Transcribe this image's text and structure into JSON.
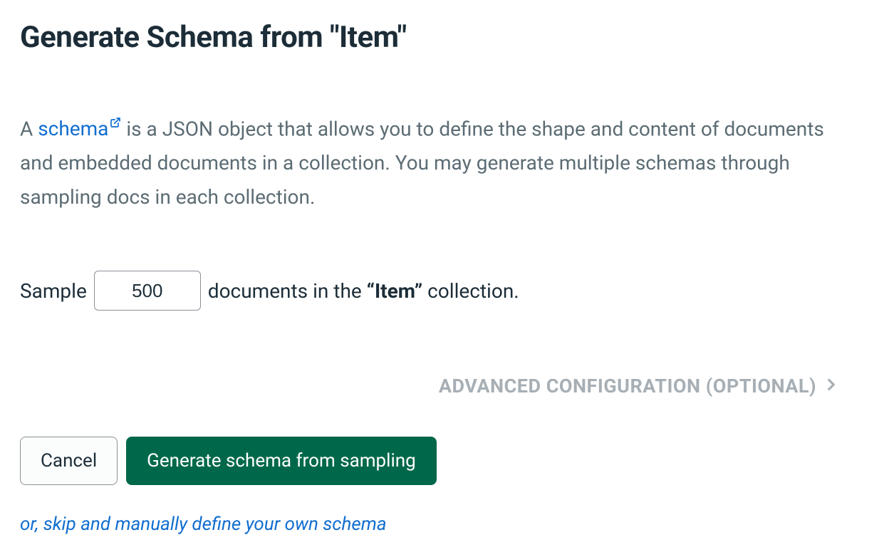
{
  "heading": "Generate Schema from \"Item\"",
  "description": {
    "prefix": "A ",
    "link_text": "schema",
    "suffix": " is a JSON object that allows you to define the shape and content of documents and embedded documents in a collection. You may generate multiple schemas through sampling docs in each collection."
  },
  "sample": {
    "label_before": "Sample",
    "value": "500",
    "label_after_1": "documents in the ",
    "collection_bold": "“Item”",
    "label_after_2": " collection."
  },
  "advanced": {
    "label": "ADVANCED CONFIGURATION (OPTIONAL)"
  },
  "buttons": {
    "cancel": "Cancel",
    "generate": "Generate schema from sampling"
  },
  "skip_link": "or, skip and manually define your own schema"
}
